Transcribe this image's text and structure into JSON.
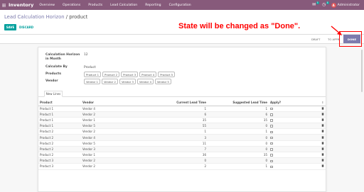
{
  "navbar": {
    "brand": "Inventory",
    "menu": [
      "Overview",
      "Operations",
      "Products",
      "Lead Calculation",
      "Reporting",
      "Configuration"
    ],
    "chat_count": "5",
    "activity_count": "8",
    "user_initial": "A",
    "user_name": "Administrator",
    "color": "#875a7b"
  },
  "breadcrumb": {
    "parent": "Lead Calculation Horizon",
    "separator": " / ",
    "current": "product"
  },
  "buttons": {
    "save": "SAVE",
    "discard": "DISCARD"
  },
  "status": {
    "stages": [
      "DRAFT",
      "TO APPR",
      "DONE"
    ],
    "active": "DONE",
    "pager_fragment": "1 / 1"
  },
  "annotation": {
    "text": "State will be changed as \"Done\".",
    "color": "#ff0000"
  },
  "form": {
    "horizon_label": "Calculation Horizon in Month",
    "horizon_value": "12",
    "calculate_by_label": "Calculate By",
    "calculate_by_value": "Product",
    "products_label": "Products",
    "products": [
      "Product 1",
      "Product 2",
      "Product 3",
      "Product 4",
      "Product 5"
    ],
    "vendor_label": "Vendor",
    "vendors": [
      "Vendor 1",
      "Vendor 2",
      "Vendor 3",
      "Vendor 4",
      "Vendor 5"
    ]
  },
  "tab": {
    "label": "New Lines"
  },
  "lines": {
    "headers": [
      "Product",
      "Vendor",
      "Current Lead Time",
      "Suggested Lead Time",
      "Apply?"
    ],
    "rows": [
      [
        "Product 1",
        "Vendor 4",
        "1",
        "1"
      ],
      [
        "Product 1",
        "Vendor 2",
        "6",
        "6"
      ],
      [
        "Product 1",
        "Vendor 1",
        "35",
        "35"
      ],
      [
        "Product 1",
        "Vendor 5",
        "55",
        "0"
      ],
      [
        "Product 2",
        "Vendor 2",
        "1",
        "1"
      ],
      [
        "Product 2",
        "Vendor 4",
        "3",
        "0"
      ],
      [
        "Product 2",
        "Vendor 5",
        "11",
        "0"
      ],
      [
        "Product 2",
        "Vendor 3",
        "7",
        "0"
      ],
      [
        "Product 2",
        "Vendor 1",
        "36",
        "35"
      ],
      [
        "Product 3",
        "Vendor 2",
        "0",
        "0"
      ],
      [
        "Product 3",
        "Vendor 2",
        "2",
        "1"
      ]
    ]
  }
}
